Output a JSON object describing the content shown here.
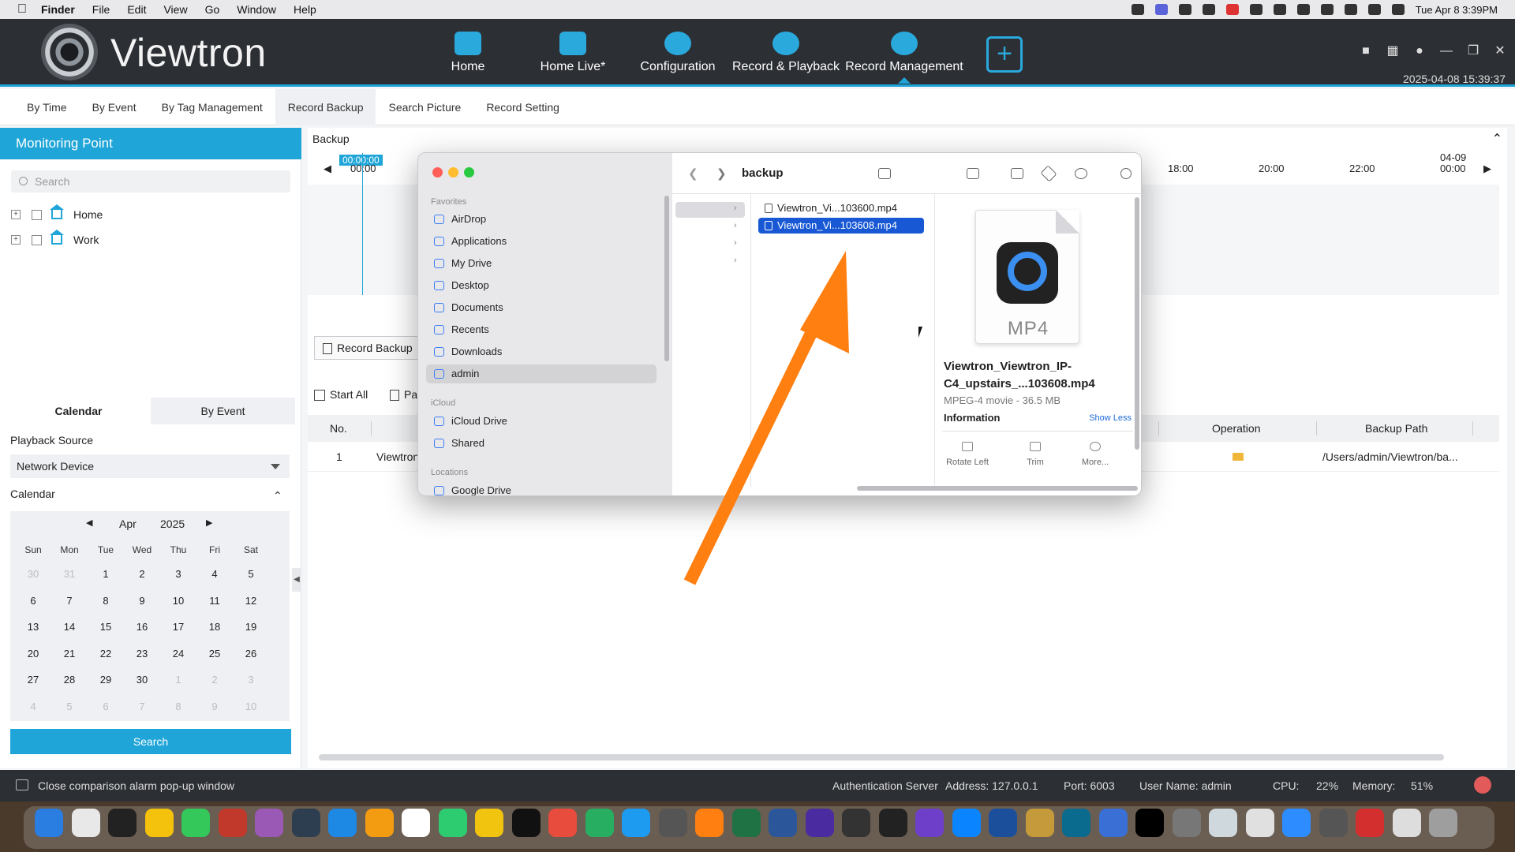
{
  "menubar": {
    "app": "Finder",
    "items": [
      "File",
      "Edit",
      "View",
      "Go",
      "Window",
      "Help"
    ],
    "clock": "Tue Apr 8  3:39PM"
  },
  "header": {
    "brand": "Viewtron",
    "nav": [
      {
        "label": "Home"
      },
      {
        "label": "Home Live*"
      },
      {
        "label": "Configuration"
      },
      {
        "label": "Record & Playback"
      },
      {
        "label": "Record Management"
      }
    ],
    "add_label": "+",
    "datetime": "2025-04-08 15:39:37"
  },
  "subtabs": [
    "By Time",
    "By Event",
    "By Tag Management",
    "Record Backup",
    "Search Picture",
    "Record Setting"
  ],
  "left": {
    "title": "Monitoring Point",
    "search_placeholder": "Search",
    "tree": [
      "Home",
      "Work"
    ],
    "cal_tabs": [
      "Calendar",
      "By Event"
    ],
    "playback_source_label": "Playback Source",
    "playback_source_value": "Network Device",
    "calendar_label": "Calendar",
    "month": "Apr",
    "year": "2025",
    "weekdays": [
      "Sun",
      "Mon",
      "Tue",
      "Wed",
      "Thu",
      "Fri",
      "Sat"
    ],
    "days": [
      [
        "30",
        "31",
        "1",
        "2",
        "3",
        "4",
        "5"
      ],
      [
        "6",
        "7",
        "8",
        "9",
        "10",
        "11",
        "12"
      ],
      [
        "13",
        "14",
        "15",
        "16",
        "17",
        "18",
        "19"
      ],
      [
        "20",
        "21",
        "22",
        "23",
        "24",
        "25",
        "26"
      ],
      [
        "27",
        "28",
        "29",
        "30",
        "1",
        "2",
        "3"
      ],
      [
        "4",
        "5",
        "6",
        "7",
        "8",
        "9",
        "10"
      ]
    ],
    "search_button": "Search"
  },
  "content": {
    "backup_label": "Backup",
    "cursor_time": "00:00:00",
    "ticks": [
      "00:00",
      "18:00",
      "20:00",
      "22:00",
      "04-09",
      "00:00"
    ],
    "record_backup_button": "Record Backup",
    "start_all": "Start All",
    "pause_all": "Pa",
    "columns": {
      "no": "No.",
      "operation": "Operation",
      "backup_path": "Backup Path"
    },
    "row": {
      "no": "1",
      "name": "Viewtron",
      "path": "/Users/admin/Viewtron/ba..."
    }
  },
  "finder": {
    "title": "backup",
    "favorites_label": "Favorites",
    "favorites": [
      "AirDrop",
      "Applications",
      "My Drive",
      "Desktop",
      "Documents",
      "Recents",
      "Downloads",
      "admin"
    ],
    "icloud_label": "iCloud",
    "icloud": [
      "iCloud Drive",
      "Shared"
    ],
    "locations_label": "Locations",
    "locations": [
      "Google Drive"
    ],
    "files": [
      "Viewtron_Vi...103600.mp4",
      "Viewtron_Vi...103608.mp4"
    ],
    "preview": {
      "icon_label": "MP4",
      "name": "Viewtron_Viewtron_IP-C4_upstairs_...103608.mp4",
      "meta": "MPEG-4 movie - 36.5 MB",
      "info_label": "Information",
      "show_less": "Show Less",
      "actions": [
        "Rotate Left",
        "Trim",
        "More..."
      ]
    }
  },
  "statusbar": {
    "message": "Close comparison alarm pop-up window",
    "auth": "Authentication Server",
    "address": "Address: 127.0.0.1",
    "port": "Port: 6003",
    "user": "User Name: admin",
    "cpu": "CPU:",
    "cpu_value": "22%",
    "memory": "Memory:",
    "memory_value": "51%"
  },
  "colors": {
    "accent": "#1fa5d8",
    "arrow": "#ff7f11",
    "finder_selection": "#1858d4"
  }
}
